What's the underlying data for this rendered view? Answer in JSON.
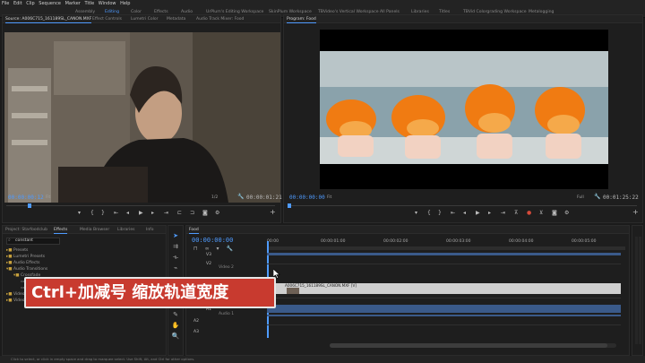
{
  "menu": [
    "File",
    "Edit",
    "Clip",
    "Sequence",
    "Marker",
    "Title",
    "Window",
    "Help"
  ],
  "workspaces": [
    {
      "label": "Assembly",
      "active": false
    },
    {
      "label": "Editing",
      "active": true
    },
    {
      "label": "Color",
      "active": false
    },
    {
      "label": "Effects",
      "active": false
    },
    {
      "label": "Audio",
      "active": false
    },
    {
      "label": "UrPlum's Editing Workspace",
      "active": false
    },
    {
      "label": "SkinPlum Workspace",
      "active": false
    },
    {
      "label": "TBVideo's Vertical Workspace",
      "active": false
    },
    {
      "label": "All Panels",
      "active": false
    },
    {
      "label": "Libraries",
      "active": false
    },
    {
      "label": "Titles",
      "active": false
    },
    {
      "label": "TBVid Colorgrading Workspace",
      "active": false
    },
    {
      "label": "Metalogging",
      "active": false
    }
  ],
  "source": {
    "tabs": [
      "Source: A006C715_161189SL_CANON.MXF",
      "Effect Controls",
      "Lumetri Color",
      "Metadata",
      "Audio Track Mixer: Food"
    ],
    "timecode_in": "00:00:00:12",
    "fit": "Fit",
    "page": "1/2",
    "timecode_out": "00:00:01:21"
  },
  "program": {
    "tab": "Program: Food",
    "timecode_in": "00:00:00:00",
    "fit": "Fit",
    "page": "Full",
    "timecode_out": "00:01:25:22"
  },
  "project": {
    "tabs": [
      "Project: Starfoodclub",
      "Effects",
      "Media Browser",
      "Libraries",
      "Info"
    ],
    "search": "constant",
    "items": [
      "Presets",
      "Lumetri Presets",
      "Audio Effects",
      "Audio Transitions",
      "Crossfade",
      "Constant Gain",
      "Constant Power",
      "Video Effects",
      "Video Transitions"
    ]
  },
  "timeline": {
    "tab": "Food",
    "timecode": "00:00:00:00",
    "ruler": [
      "00:00",
      "00:00:01:00",
      "00:00:02:00",
      "00:00:03:00",
      "00:00:04:00",
      "00:00:05:00"
    ],
    "tracks": [
      {
        "id": "V3",
        "name": ""
      },
      {
        "id": "V2",
        "name": "Video 2"
      },
      {
        "id": "V1",
        "name": "Video 1"
      },
      {
        "id": "A1",
        "name": "Audio 1"
      },
      {
        "id": "A2",
        "name": "Audio 2"
      },
      {
        "id": "A3",
        "name": "Audio 3"
      }
    ],
    "clip_label": "A006C715_161189SL_CANON.MXF [V]"
  },
  "caption": "Ctrl+加减号 缩放轨道宽度",
  "status": "Click to select, or click in empty space and drag to marquee select. Use Shift, Alt, and Ctrl for other options.",
  "colors": {
    "accent": "#4f9bff",
    "caption_bg": "#c83a2f",
    "clip_blue": "#3a5a8a"
  }
}
